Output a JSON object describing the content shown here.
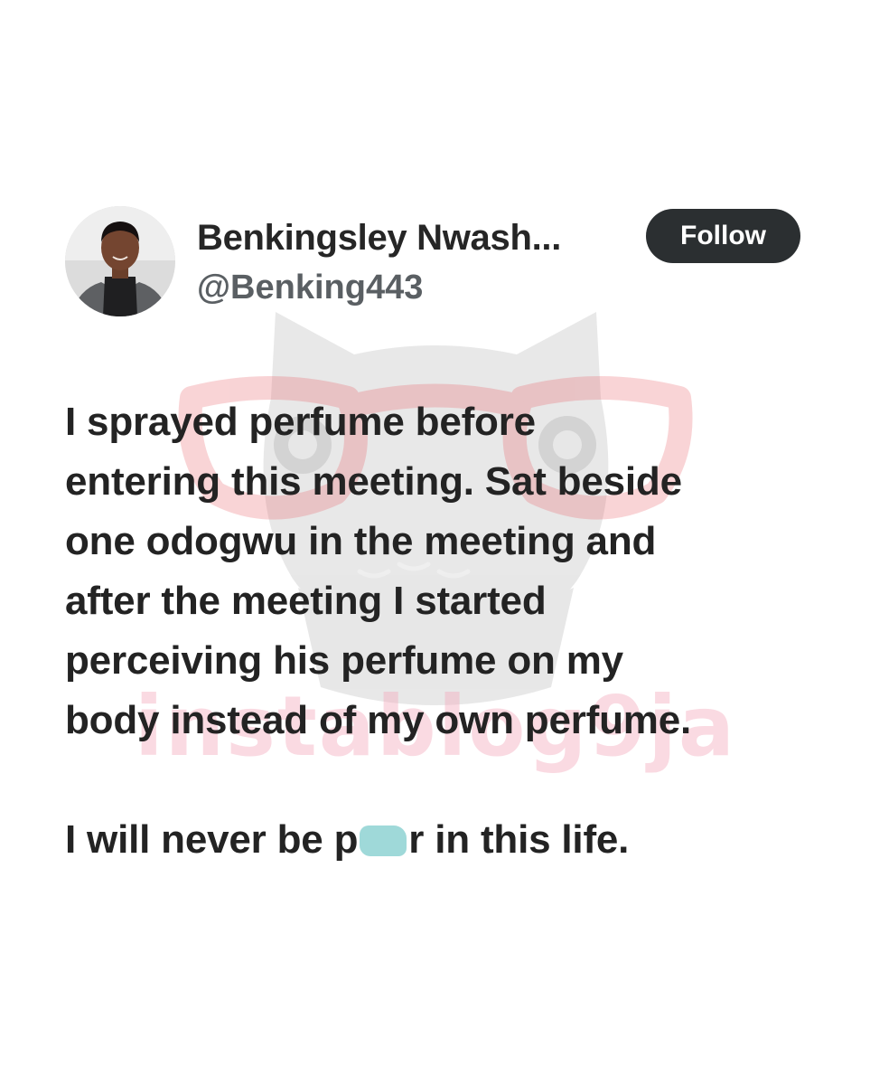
{
  "tweet": {
    "display_name": "Benkingsley Nwash...",
    "handle": "@Benking443",
    "follow_label": "Follow",
    "body_lines": [
      "I sprayed perfume before",
      "entering this meeting. Sat beside",
      "one odogwu in the meeting and",
      "after the meeting I started",
      "perceiving his perfume on my",
      "body instead of my own perfume."
    ],
    "closing_line": {
      "before_censor": "I will never be p",
      "after_censor": "r in this life."
    }
  },
  "watermark": {
    "text": "instablog9ja"
  },
  "colors": {
    "background": "#ffffff",
    "text": "#232323",
    "handle": "#5a5f63",
    "follow_button_bg": "#2b2f31",
    "follow_button_text": "#ffffff",
    "censor": "#9fd9d9",
    "watermark_owl": "#8a8a8a",
    "watermark_glasses": "#e8575f"
  },
  "icons": {
    "avatar": "profile-photo",
    "watermark": "owl-with-glasses-logo"
  }
}
